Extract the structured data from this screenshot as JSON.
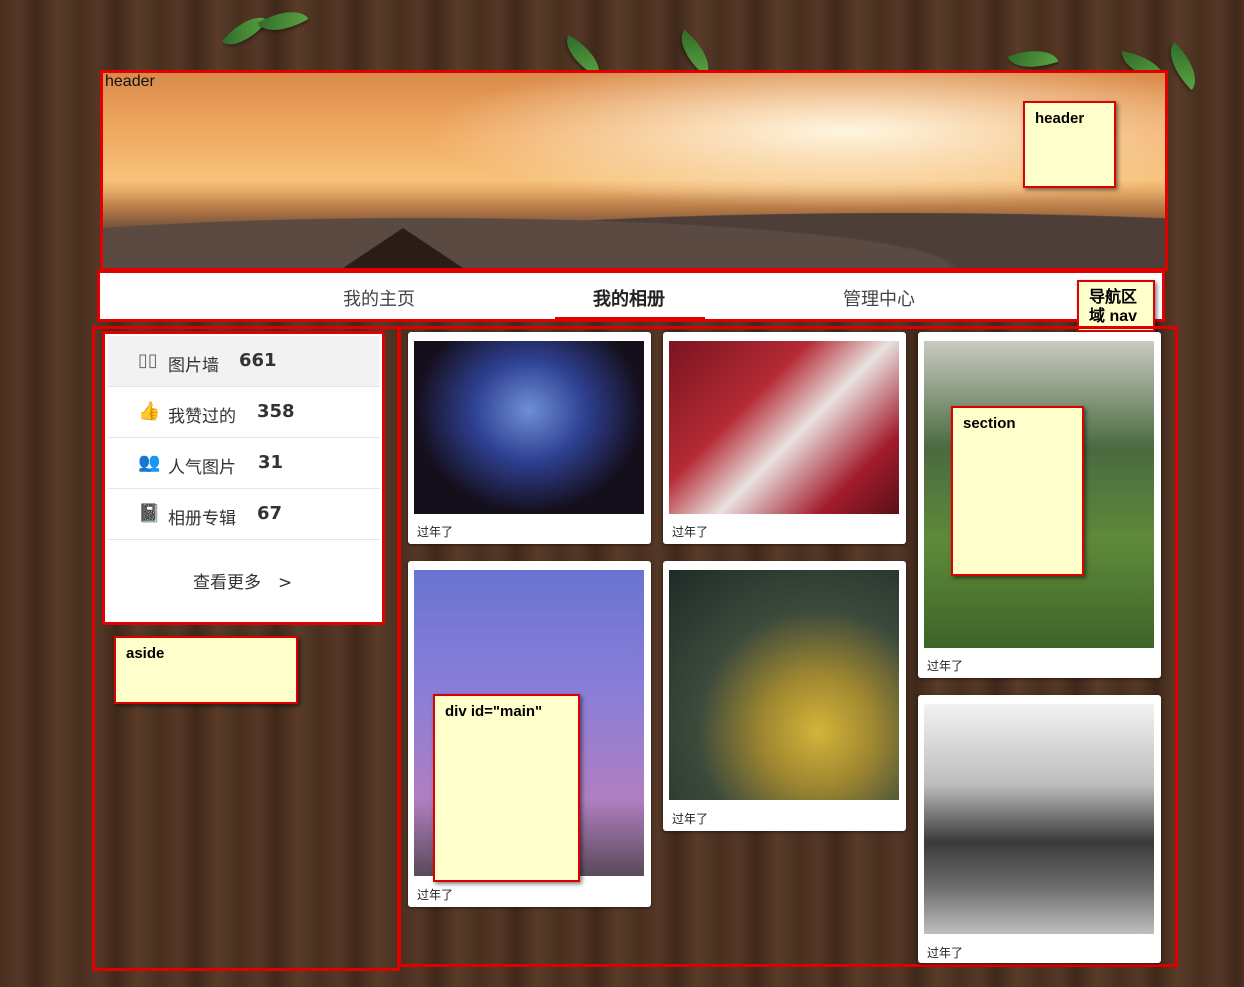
{
  "header": {
    "corner_label": "header",
    "note": "header"
  },
  "nav": {
    "items": [
      {
        "label": "我的主页"
      },
      {
        "label": "我的相册"
      },
      {
        "label": "管理中心"
      }
    ],
    "note": "导航区域 nav"
  },
  "aside": {
    "items": [
      {
        "icon": "grid-icon",
        "label": "图片墙",
        "count": "661"
      },
      {
        "icon": "thumbs-up-icon",
        "label": "我赞过的",
        "count": "358"
      },
      {
        "icon": "users-icon",
        "label": "人气图片",
        "count": "31"
      },
      {
        "icon": "album-icon",
        "label": "相册专辑",
        "count": "67"
      }
    ],
    "more": "查看更多　>",
    "note": "aside"
  },
  "main": {
    "note": "div id=\"main\"",
    "section_note": "section",
    "photos": [
      {
        "caption": "过年了"
      },
      {
        "caption": "过年了"
      },
      {
        "caption": "过年了"
      },
      {
        "caption": "过年了"
      },
      {
        "caption": "过年了"
      },
      {
        "caption": "过年了"
      }
    ]
  },
  "colors": {
    "accent": "#e00000",
    "note_bg": "#ffffcc"
  }
}
